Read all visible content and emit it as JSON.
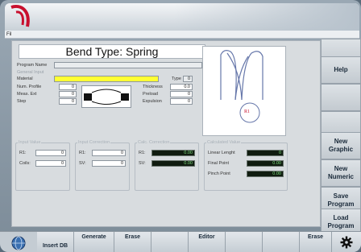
{
  "app": {
    "menu_file": "Fil"
  },
  "main": {
    "title": "Bend Type: Spring",
    "program_name_label": "Program Name",
    "program_name_value": "",
    "general_input_title": "General Input",
    "material_label": "Material",
    "material_value": "",
    "type_label": "Type",
    "type_value": "0",
    "num_profile_label": "Num. Profile",
    "num_profile_value": "0",
    "meas_ext_label": "Meas. Ext",
    "meas_ext_value": "0",
    "step_label": "Step",
    "step_value": "0",
    "thickness_label": "Thickness",
    "thickness_value": "0.0",
    "preload_label": "Preload",
    "preload_value": "0",
    "expulsion_label": "Expulsion",
    "expulsion_value": "0",
    "spring_badge": "R1"
  },
  "input_value": {
    "title": "Input Value",
    "r1_label": "R1:",
    "r1_value": "0",
    "coils_label": "Coils:",
    "coils_value": "0"
  },
  "input_correction": {
    "title": "Input Correction",
    "r1_label": "R1:",
    "r1_value": "0",
    "sv_label": "SV:",
    "sv_value": "0"
  },
  "calc_correction": {
    "title": "Calc. Correction",
    "r1_label": "R1:",
    "r1_value": "0.00",
    "sv_label": "SV:",
    "sv_value": "0.00"
  },
  "calculated_value": {
    "title": "Calculated Value",
    "linear_length_label": "Linear Lenght",
    "linear_length_value": "0",
    "final_point_label": "Final Point",
    "final_point_value": "0.00",
    "pinch_point_label": "Pinch Point",
    "pinch_point_value": "0.00"
  },
  "rightbar": {
    "help": "Help",
    "new_graphic": "New\nGraphic",
    "new_numeric": "New\nNumeric",
    "save_program": "Save\nProgram",
    "load_program": "Load\nProgram"
  },
  "bottombar": {
    "insert_db": "Insert DB",
    "generate": "Generate",
    "erase1": "Erase",
    "editor": "Editor",
    "erase2": "Erase"
  },
  "colors": {
    "accent_red": "#c8102e",
    "material_yellow": "#ffff33"
  }
}
